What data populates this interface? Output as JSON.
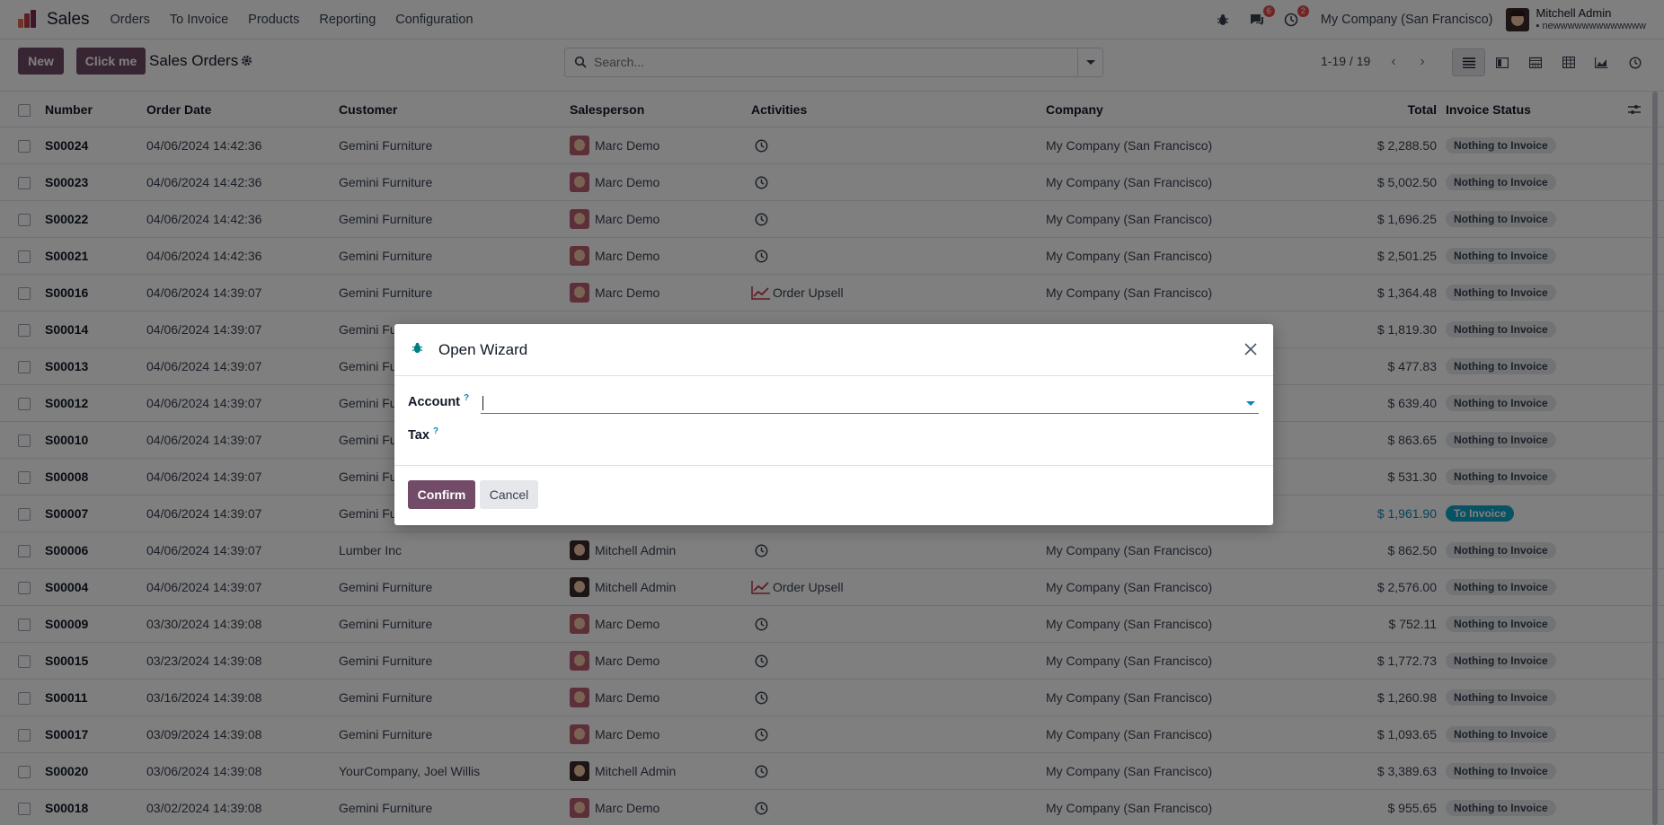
{
  "navbar": {
    "app_title": "Sales",
    "menu": [
      "Orders",
      "To Invoice",
      "Products",
      "Reporting",
      "Configuration"
    ],
    "messages_count": "6",
    "activities_count": "2",
    "company": "My Company (San Francisco)",
    "user_name": "Mitchell Admin",
    "user_db": "newwwwwwwwwwwww"
  },
  "control": {
    "new_label": "New",
    "click_me_label": "Click me",
    "title": "Sales Orders",
    "search_placeholder": "Search...",
    "pager": "1-19 / 19"
  },
  "table": {
    "headers": {
      "number": "Number",
      "order_date": "Order Date",
      "customer": "Customer",
      "salesperson": "Salesperson",
      "activities": "Activities",
      "company": "Company",
      "total": "Total",
      "invoice_status": "Invoice Status"
    },
    "rows": [
      {
        "number": "S00024",
        "date": "04/06/2024 14:42:36",
        "customer": "Gemini Furniture",
        "salesperson": "Marc Demo",
        "activity": "",
        "company": "My Company (San Francisco)",
        "total": "$ 2,288.50",
        "status": "Nothing to Invoice"
      },
      {
        "number": "S00023",
        "date": "04/06/2024 14:42:36",
        "customer": "Gemini Furniture",
        "salesperson": "Marc Demo",
        "activity": "",
        "company": "My Company (San Francisco)",
        "total": "$ 5,002.50",
        "status": "Nothing to Invoice"
      },
      {
        "number": "S00022",
        "date": "04/06/2024 14:42:36",
        "customer": "Gemini Furniture",
        "salesperson": "Marc Demo",
        "activity": "",
        "company": "My Company (San Francisco)",
        "total": "$ 1,696.25",
        "status": "Nothing to Invoice"
      },
      {
        "number": "S00021",
        "date": "04/06/2024 14:42:36",
        "customer": "Gemini Furniture",
        "salesperson": "Marc Demo",
        "activity": "",
        "company": "My Company (San Francisco)",
        "total": "$ 2,501.25",
        "status": "Nothing to Invoice"
      },
      {
        "number": "S00016",
        "date": "04/06/2024 14:39:07",
        "customer": "Gemini Furniture",
        "salesperson": "Marc Demo",
        "activity": "Order Upsell",
        "company": "My Company (San Francisco)",
        "total": "$ 1,364.48",
        "status": "Nothing to Invoice"
      },
      {
        "number": "S00014",
        "date": "04/06/2024 14:39:07",
        "customer": "Gemini Furniture",
        "salesperson": "",
        "activity": "",
        "company": "",
        "total": "$ 1,819.30",
        "status": "Nothing to Invoice"
      },
      {
        "number": "S00013",
        "date": "04/06/2024 14:39:07",
        "customer": "Gemini Furniture",
        "salesperson": "",
        "activity": "",
        "company": "",
        "total": "$ 477.83",
        "status": "Nothing to Invoice"
      },
      {
        "number": "S00012",
        "date": "04/06/2024 14:39:07",
        "customer": "Gemini Furniture",
        "salesperson": "",
        "activity": "",
        "company": "",
        "total": "$ 639.40",
        "status": "Nothing to Invoice"
      },
      {
        "number": "S00010",
        "date": "04/06/2024 14:39:07",
        "customer": "Gemini Furniture",
        "salesperson": "",
        "activity": "",
        "company": "",
        "total": "$ 863.65",
        "status": "Nothing to Invoice"
      },
      {
        "number": "S00008",
        "date": "04/06/2024 14:39:07",
        "customer": "Gemini Furniture",
        "salesperson": "",
        "activity": "",
        "company": "",
        "total": "$ 531.30",
        "status": "Nothing to Invoice"
      },
      {
        "number": "S00007",
        "date": "04/06/2024 14:39:07",
        "customer": "Gemini Furniture",
        "salesperson": "",
        "activity": "",
        "company": "",
        "total": "$ 1,961.90",
        "status": "To Invoice"
      },
      {
        "number": "S00006",
        "date": "04/06/2024 14:39:07",
        "customer": "Lumber Inc",
        "salesperson": "Mitchell Admin",
        "activity": "",
        "company": "My Company (San Francisco)",
        "total": "$ 862.50",
        "status": "Nothing to Invoice"
      },
      {
        "number": "S00004",
        "date": "04/06/2024 14:39:07",
        "customer": "Gemini Furniture",
        "salesperson": "Mitchell Admin",
        "activity": "Order Upsell",
        "company": "My Company (San Francisco)",
        "total": "$ 2,576.00",
        "status": "Nothing to Invoice"
      },
      {
        "number": "S00009",
        "date": "03/30/2024 14:39:08",
        "customer": "Gemini Furniture",
        "salesperson": "Marc Demo",
        "activity": "",
        "company": "My Company (San Francisco)",
        "total": "$ 752.11",
        "status": "Nothing to Invoice"
      },
      {
        "number": "S00015",
        "date": "03/23/2024 14:39:08",
        "customer": "Gemini Furniture",
        "salesperson": "Marc Demo",
        "activity": "",
        "company": "My Company (San Francisco)",
        "total": "$ 1,772.73",
        "status": "Nothing to Invoice"
      },
      {
        "number": "S00011",
        "date": "03/16/2024 14:39:08",
        "customer": "Gemini Furniture",
        "salesperson": "Marc Demo",
        "activity": "",
        "company": "My Company (San Francisco)",
        "total": "$ 1,260.98",
        "status": "Nothing to Invoice"
      },
      {
        "number": "S00017",
        "date": "03/09/2024 14:39:08",
        "customer": "Gemini Furniture",
        "salesperson": "Marc Demo",
        "activity": "",
        "company": "My Company (San Francisco)",
        "total": "$ 1,093.65",
        "status": "Nothing to Invoice"
      },
      {
        "number": "S00020",
        "date": "03/06/2024 14:39:08",
        "customer": "YourCompany, Joel Willis",
        "salesperson": "Mitchell Admin",
        "activity": "",
        "company": "My Company (San Francisco)",
        "total": "$ 3,389.63",
        "status": "Nothing to Invoice"
      },
      {
        "number": "S00018",
        "date": "03/02/2024 14:39:08",
        "customer": "Gemini Furniture",
        "salesperson": "Marc Demo",
        "activity": "",
        "company": "My Company (San Francisco)",
        "total": "$ 955.65",
        "status": "Nothing to Invoice"
      }
    ]
  },
  "modal": {
    "title": "Open Wizard",
    "account_label": "Account",
    "tax_label": "Tax",
    "help_mark": "?",
    "confirm_label": "Confirm",
    "cancel_label": "Cancel"
  },
  "colors": {
    "brand": "#714b67",
    "link": "#0e87b8",
    "to_invoice_badge": "#0ea5c6"
  }
}
